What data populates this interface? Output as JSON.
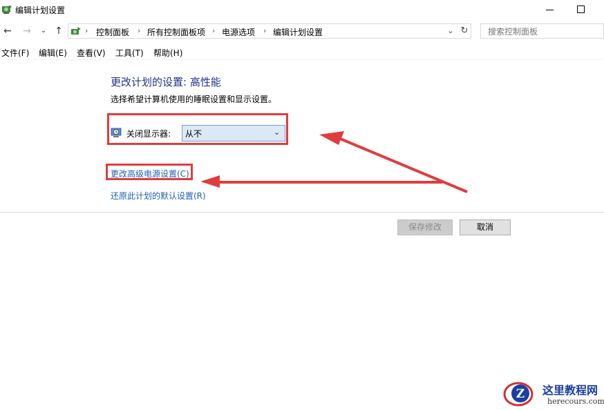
{
  "window": {
    "title": "编辑计划设置",
    "minimize_icon": "minimize-icon",
    "maximize_icon": "maximize-icon"
  },
  "nav": {
    "back_icon": "arrow-left-icon",
    "forward_icon": "arrow-right-icon",
    "recent_icon": "chevron-down-icon",
    "up_icon": "arrow-up-icon",
    "breadcrumbs": [
      "控制面板",
      "所有控制面板项",
      "电源选项",
      "编辑计划设置"
    ],
    "refresh_icon": "refresh-icon"
  },
  "search": {
    "placeholder": "搜索控制面板"
  },
  "menu": {
    "items": [
      "文件(F)",
      "编辑(E)",
      "查看(V)",
      "工具(T)",
      "帮助(H)"
    ]
  },
  "main": {
    "title": "更改计划的设置: 高性能",
    "description": "选择希望计算机使用的睡眠设置和显示设置。",
    "display_off_label": "关闭显示器:",
    "display_off_value": "从不",
    "advanced_link": "更改高级电源设置(C)",
    "restore_link": "还原此计划的默认设置(R)"
  },
  "buttons": {
    "save": "保存修改",
    "cancel": "取消"
  },
  "annotations": {
    "highlight_color": "#e03c3c"
  },
  "watermark": {
    "title": "这里教程网",
    "url": "herecours.com",
    "logo_letter": "Z"
  }
}
